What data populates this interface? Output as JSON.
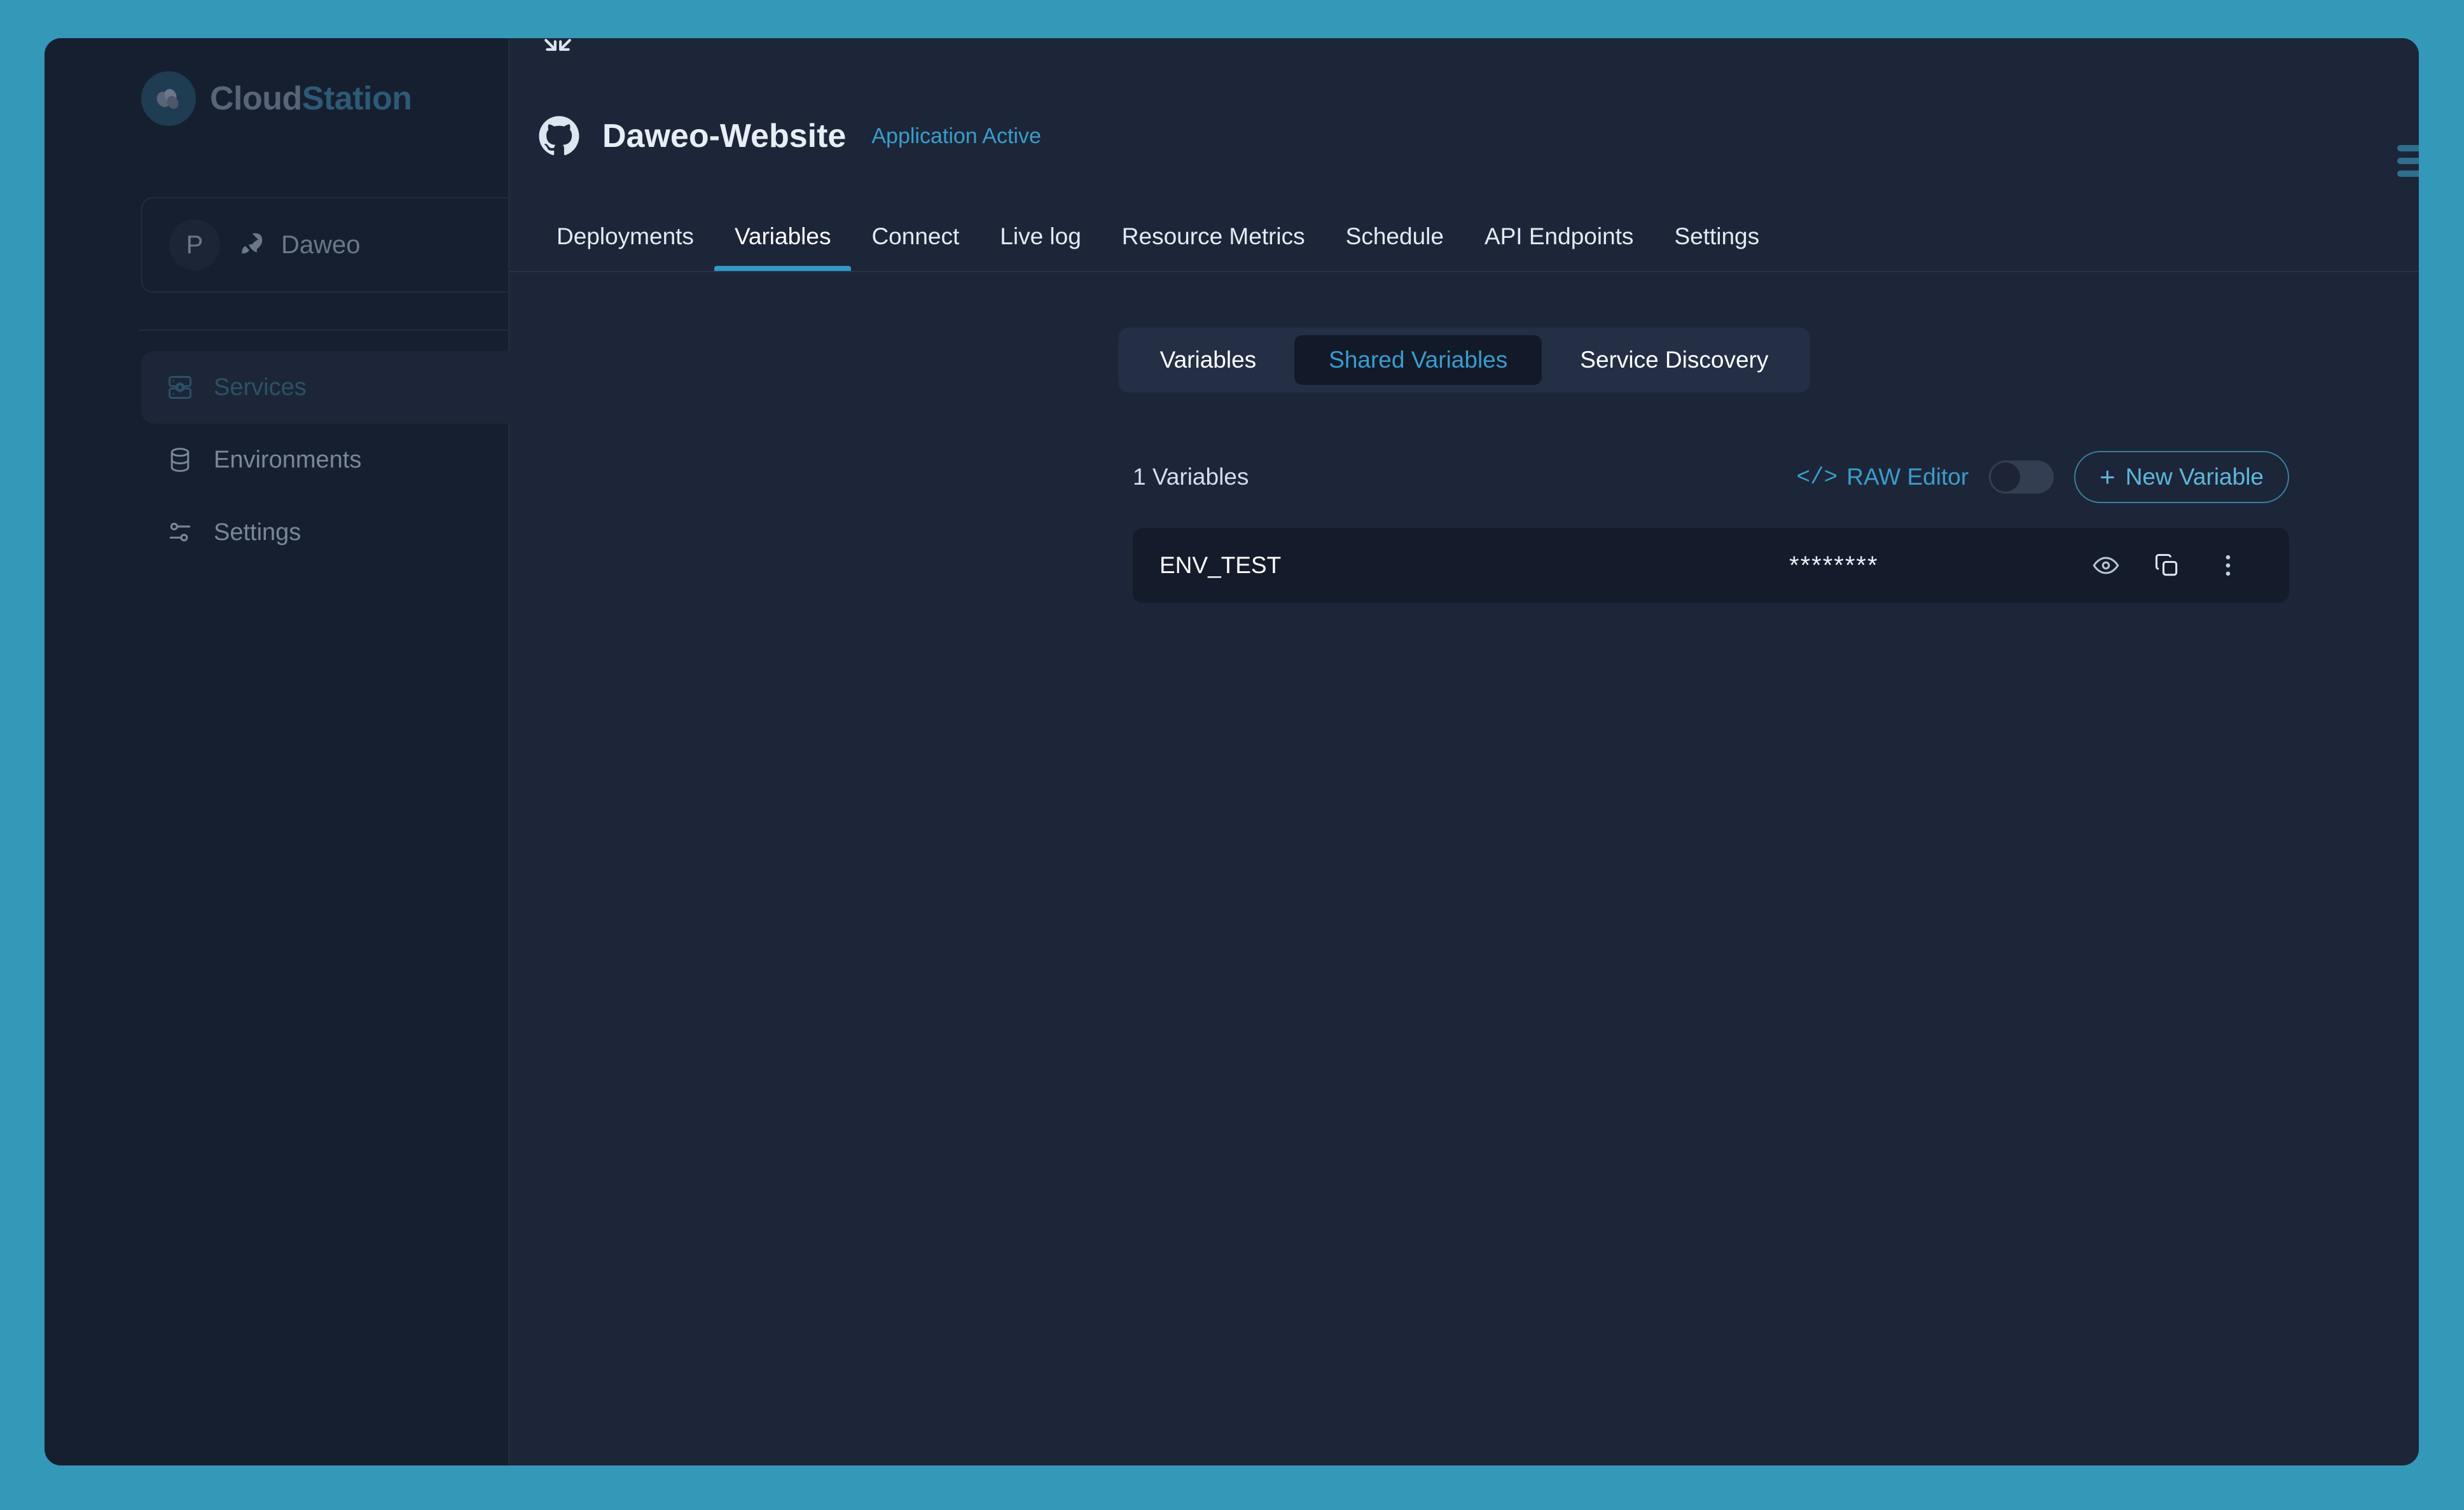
{
  "theme": {
    "page_background": "#3498b8",
    "app_background": "#161f30",
    "main_background": "#1c2638",
    "accent": "#3498c4",
    "link": "#3b9ccc",
    "row_background": "#141b2a"
  },
  "sidebar": {
    "brand": {
      "text_part1": "Cloud",
      "text_part2": "Station",
      "icon": "cloud-logo-icon"
    },
    "project": {
      "avatar_initial": "P",
      "icon": "rocket-icon",
      "name": "Daweo"
    },
    "items": [
      {
        "label": "Services",
        "icon": "server-gear-icon",
        "active": true
      },
      {
        "label": "Environments",
        "icon": "database-icon",
        "active": false
      },
      {
        "label": "Settings",
        "icon": "sliders-icon",
        "active": false
      }
    ]
  },
  "header": {
    "collapse_icon": "collapse-arrows-icon",
    "repo_icon": "github-icon",
    "title": "Daweo-Website",
    "status": "Application Active",
    "edge_menu_icon": "hamburger-menu-icon"
  },
  "tabs": [
    {
      "label": "Deployments",
      "active": false
    },
    {
      "label": "Variables",
      "active": true
    },
    {
      "label": "Connect",
      "active": false
    },
    {
      "label": "Live log",
      "active": false
    },
    {
      "label": "Resource Metrics",
      "active": false
    },
    {
      "label": "Schedule",
      "active": false
    },
    {
      "label": "API Endpoints",
      "active": false
    },
    {
      "label": "Settings",
      "active": false
    }
  ],
  "segmented": [
    {
      "label": "Variables",
      "active": false
    },
    {
      "label": "Shared Variables",
      "active": true
    },
    {
      "label": "Service Discovery",
      "active": false
    }
  ],
  "toolbar": {
    "count_label": "1 Variables",
    "raw_editor_label": "RAW Editor",
    "raw_editor_icon": "code-brackets-icon",
    "raw_editor_enabled": false,
    "new_variable_label": "New Variable",
    "new_variable_plus": "+"
  },
  "variables": [
    {
      "key": "ENV_TEST",
      "value_masked": "********",
      "actions": [
        "eye-icon",
        "copy-icon",
        "more-vertical-icon"
      ]
    }
  ]
}
